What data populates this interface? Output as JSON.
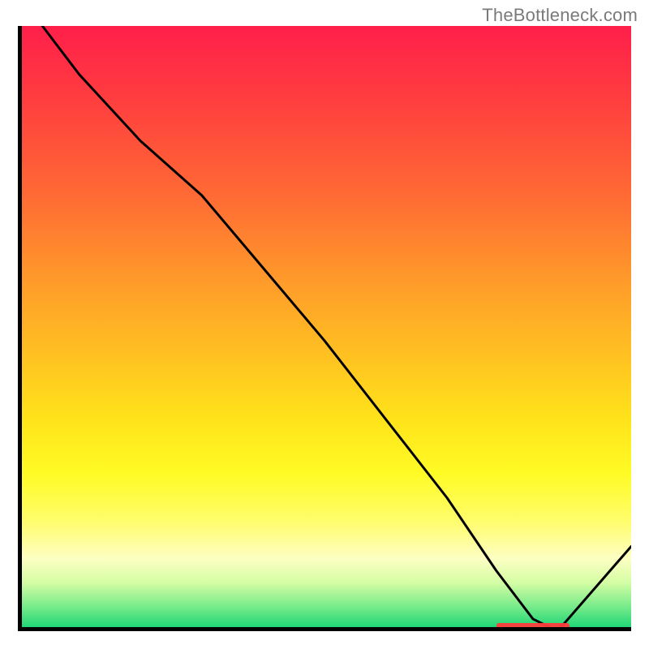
{
  "attribution": "TheBottleneck.com",
  "colors": {
    "line": "#000000",
    "axis": "#000000",
    "marker": "#ff3b3b"
  },
  "chart_data": {
    "type": "line",
    "xlim": [
      0,
      100
    ],
    "ylim": [
      0,
      100
    ],
    "xlabel": "",
    "ylabel": "",
    "series": [
      {
        "name": "curve",
        "x": [
          4,
          10,
          20,
          30,
          40,
          50,
          60,
          70,
          78,
          84,
          88,
          100
        ],
        "values": [
          100,
          92,
          81,
          72,
          60,
          48,
          35,
          22,
          10,
          2,
          0,
          14
        ]
      }
    ],
    "min_region": {
      "x_start": 78,
      "x_end": 90,
      "y": 0
    },
    "gradient_note": "red (top) → orange → yellow → pale → green (bottom)"
  }
}
